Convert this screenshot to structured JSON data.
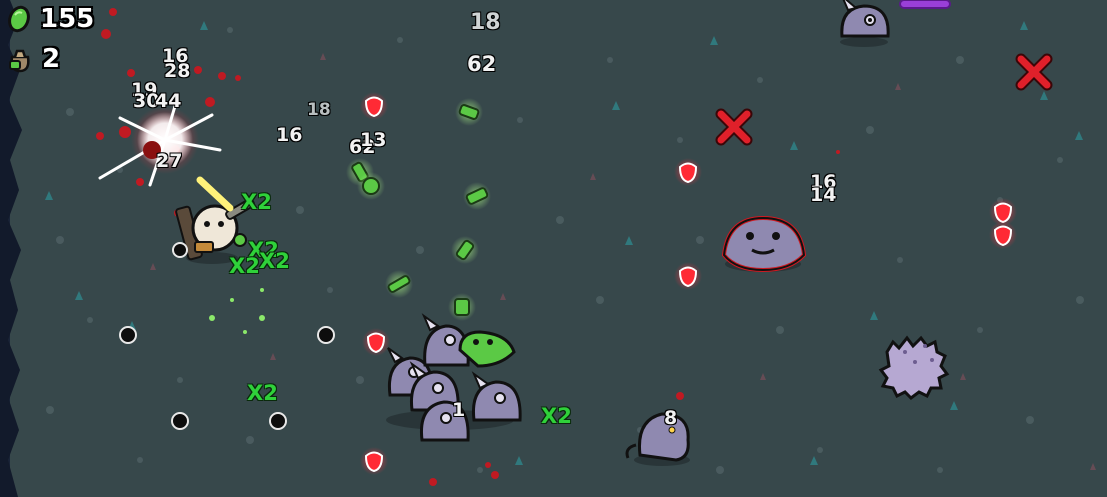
{
  "hud": {
    "materials_count": "155",
    "bags_count": "2",
    "materials_icon": "green-material-icon",
    "bags_icon": "loot-bag-icon"
  },
  "damage_numbers": [
    "18",
    "62",
    "16",
    "28",
    "19",
    "30",
    "44",
    "27",
    "16",
    "18",
    "62",
    "13",
    "16",
    "14",
    "1",
    "8"
  ],
  "multipliers": [
    "X2",
    "X2",
    "X2",
    "X2",
    "X2",
    "X2"
  ],
  "colors": {
    "ground": "#37484b",
    "material_green": "#5bc945",
    "multiplier_green": "#2fd13a",
    "enemy_purple": "#8f89b0",
    "danger_red": "#e0202a"
  }
}
